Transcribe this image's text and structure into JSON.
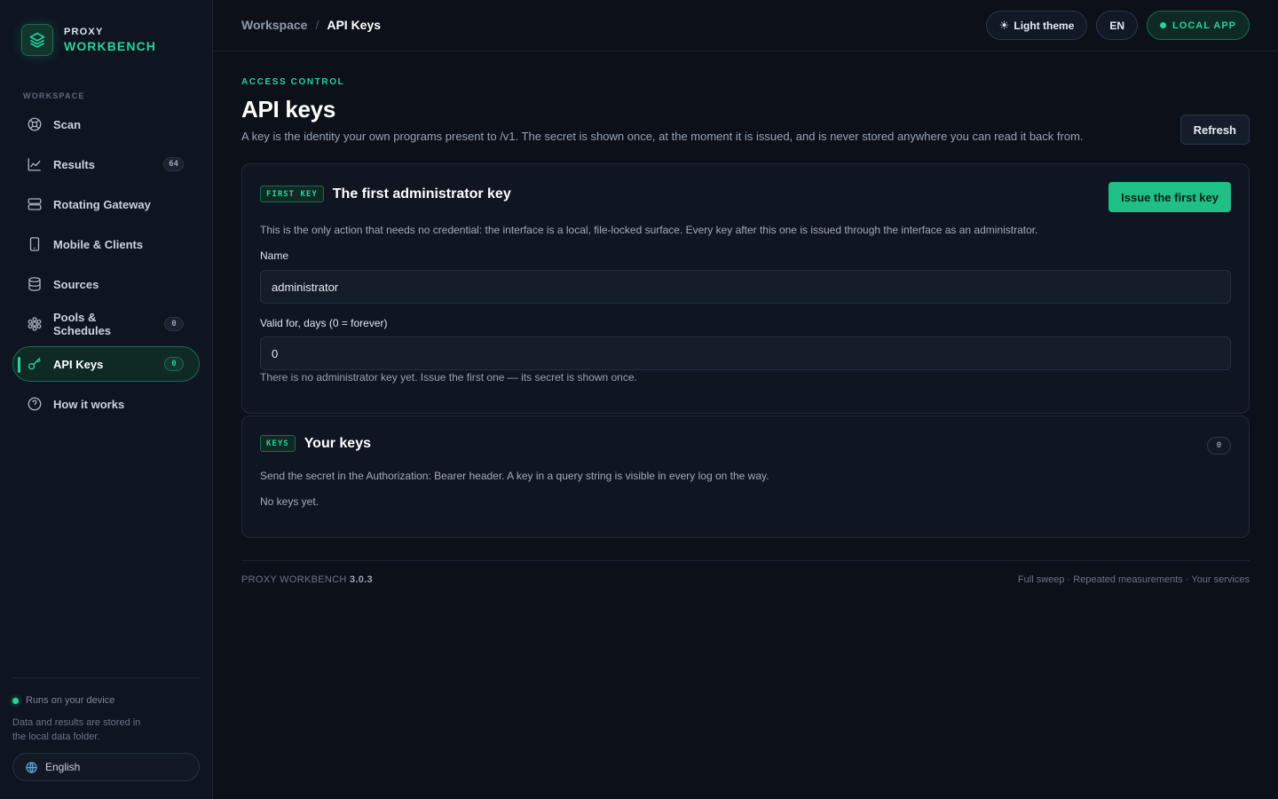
{
  "brand": {
    "top": "PROXY",
    "bottom": "WORKBENCH"
  },
  "sidebar": {
    "section": "WORKSPACE",
    "items": [
      {
        "label": "Scan",
        "icon": "scan-icon"
      },
      {
        "label": "Results",
        "icon": "chart-icon",
        "badge": "64"
      },
      {
        "label": "Rotating Gateway",
        "icon": "server-icon"
      },
      {
        "label": "Mobile & Clients",
        "icon": "mobile-icon"
      },
      {
        "label": "Sources",
        "icon": "database-icon"
      },
      {
        "label_line1": "Pools &",
        "label_line2": "Schedules",
        "icon": "cog-cluster-icon",
        "badge": "0"
      },
      {
        "label": "API Keys",
        "icon": "key-icon",
        "badge": "0",
        "active": true
      },
      {
        "label": "How it works",
        "icon": "help-icon"
      }
    ],
    "device_status": "Runs on your device",
    "device_note": "Data and results are stored in the local data folder.",
    "language": "English"
  },
  "topbar": {
    "breadcrumb_root": "Workspace",
    "breadcrumb_sep": "/",
    "breadcrumb_current": "API Keys",
    "theme_button": "Light theme",
    "lang_button": "EN",
    "local_badge": "LOCAL APP"
  },
  "main": {
    "eyebrow": "ACCESS CONTROL",
    "title": "API keys",
    "description": "A key is the identity your own programs present to /v1. The secret is shown once, at the moment it is issued, and is never stored anywhere you can read it back from.",
    "refresh_button": "Refresh",
    "first_key_card": {
      "tag": "FIRST KEY",
      "title": "The first administrator key",
      "button": "Issue the first key",
      "description": "This is the only action that needs no credential: the interface is a local, file-locked surface. Every key after this one is issued through the interface as an administrator.",
      "name_label": "Name",
      "name_value": "administrator",
      "valid_label": "Valid for, days (0 = forever)",
      "valid_value": "0",
      "hint": "There is no administrator key yet. Issue the first one — its secret is shown once."
    },
    "keys_card": {
      "tag": "KEYS",
      "title": "Your keys",
      "count": "0",
      "description": "Send the secret in the Authorization: Bearer header. A key in a query string is visible in every log on the way.",
      "empty": "No keys yet."
    },
    "footer": {
      "product": "PROXY WORKBENCH",
      "version": "3.0.3",
      "links": "Full sweep · Repeated measurements · Your services"
    }
  },
  "colors": {
    "accent": "#28d39a",
    "background": "#0b1019",
    "button": "#1fbf86"
  }
}
